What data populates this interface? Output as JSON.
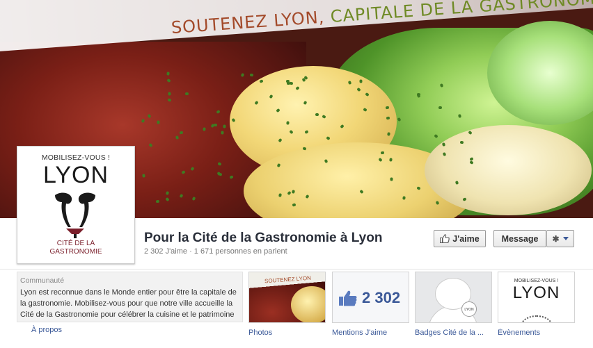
{
  "cover": {
    "slogan_part1": "SOUTENEZ LYON,",
    "slogan_part2": "CAPITALE DE LA GASTRONOMIE !"
  },
  "profile": {
    "mobilisez": "MOBILISEZ-VOUS !",
    "lyon": "LYON",
    "cite_line1": "CITÉ DE LA",
    "cite_line2": "GASTRONOMIE"
  },
  "page": {
    "title": "Pour la Cité de la Gastronomie à Lyon",
    "stats": "2 302 J'aime · 1 671 personnes en parlent"
  },
  "actions": {
    "like_label": "J'aime",
    "message_label": "Message",
    "gear_icon": "gear-icon"
  },
  "about": {
    "category": "Communauté",
    "description": "Lyon est reconnue dans le Monde entier pour être la capitale de la gastronomie. Mobilisez-vous pour que notre ville accueille la Cité de la Gastronomie pour célébrer la cuisine et le patrimoine culinaire.",
    "link": "À propos"
  },
  "tabs": [
    {
      "label": "Photos",
      "thumb_text": "SOUTENEZ LYON"
    },
    {
      "label": "Mentions J'aime",
      "count": "2 302"
    },
    {
      "label": "Badges Cité de la ...",
      "badge_text": "LYON"
    },
    {
      "label": "Évènements",
      "mobilisez": "MOBILISEZ-VOUS !",
      "lyon": "LYON"
    }
  ],
  "colors": {
    "link_blue": "#3b5998",
    "title_dark": "#2a2f3a",
    "slogan_red": "#a34a2a",
    "slogan_green": "#6f8a25"
  }
}
